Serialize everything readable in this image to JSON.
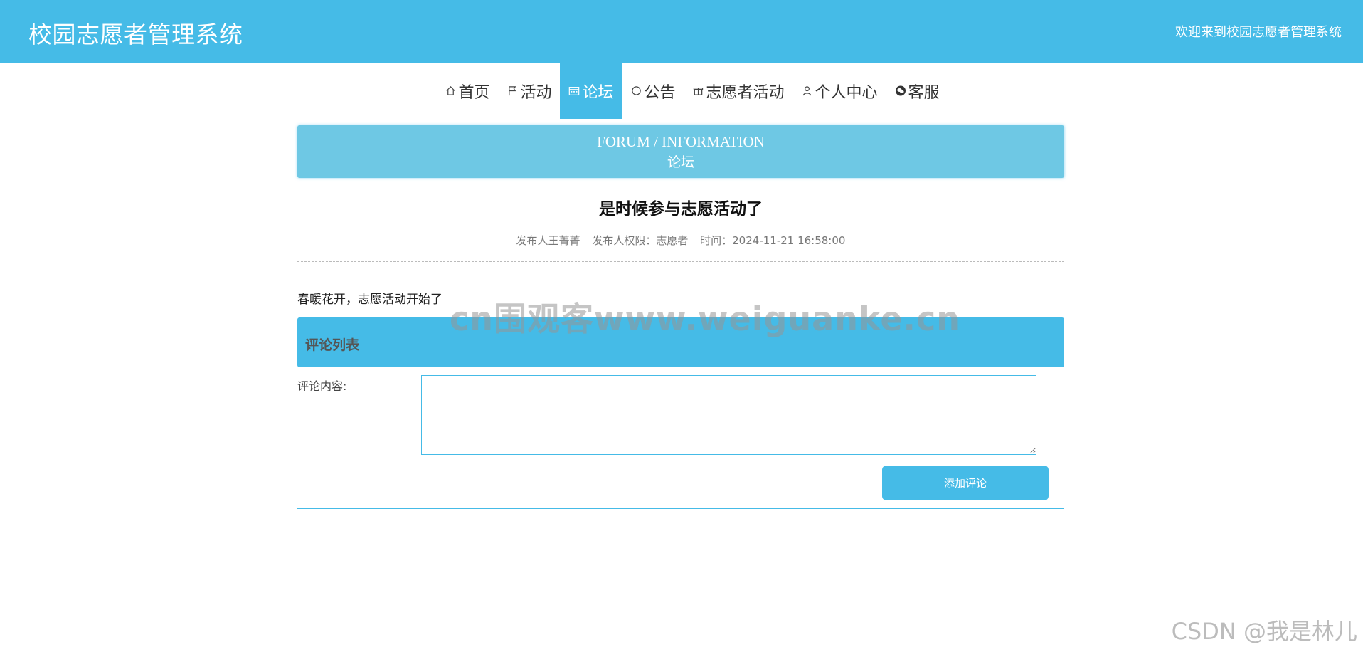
{
  "header": {
    "title": "校园志愿者管理系统",
    "welcome": "欢迎来到校园志愿者管理系统"
  },
  "nav": {
    "items": [
      {
        "label": "首页",
        "icon": "home-icon"
      },
      {
        "label": "活动",
        "icon": "flag-icon"
      },
      {
        "label": "论坛",
        "icon": "calendar-icon",
        "active": true
      },
      {
        "label": "公告",
        "icon": "circle-icon"
      },
      {
        "label": "志愿者活动",
        "icon": "gift-icon"
      },
      {
        "label": "个人中心",
        "icon": "user-icon"
      },
      {
        "label": "客服",
        "icon": "wechat-icon"
      }
    ]
  },
  "banner": {
    "en": "FORUM / INFORMATION",
    "cn": "论坛"
  },
  "post": {
    "title": "是时候参与志愿活动了",
    "author": "发布人王菁菁",
    "role": "发布人权限：志愿者",
    "time": "时间：2024-11-21 16:58:00",
    "content": "春暖花开，志愿活动开始了"
  },
  "comments": {
    "header": "评论列表",
    "form_label": "评论内容:",
    "textarea_value": "",
    "submit_label": "添加评论"
  },
  "watermarks": {
    "center": "cn围观客www.weiguanke.cn",
    "corner": "CSDN @我是林儿"
  },
  "colors": {
    "primary": "#45bbe7",
    "banner": "#6ec8e4"
  }
}
